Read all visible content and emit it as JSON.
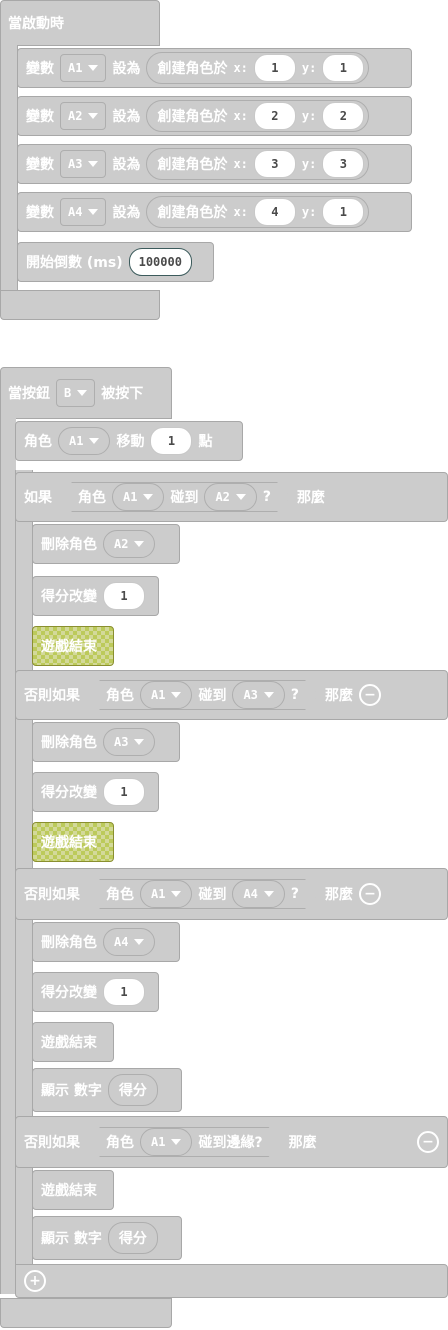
{
  "workspace": {
    "on_start": {
      "label": "當啟動時",
      "set_rows": [
        {
          "var_label": "變數",
          "var": "A1",
          "set_label": "設為",
          "create_label": "創建角色於",
          "x_label": "x:",
          "x": "1",
          "y_label": "y:",
          "y": "1"
        },
        {
          "var_label": "變數",
          "var": "A2",
          "set_label": "設為",
          "create_label": "創建角色於",
          "x_label": "x:",
          "x": "2",
          "y_label": "y:",
          "y": "2"
        },
        {
          "var_label": "變數",
          "var": "A3",
          "set_label": "設為",
          "create_label": "創建角色於",
          "x_label": "x:",
          "x": "3",
          "y_label": "y:",
          "y": "3"
        },
        {
          "var_label": "變數",
          "var": "A4",
          "set_label": "設為",
          "create_label": "創建角色於",
          "x_label": "x:",
          "x": "4",
          "y_label": "y:",
          "y": "1"
        }
      ],
      "countdown": {
        "label": "開始倒數 (ms)",
        "value": "100000"
      }
    },
    "on_button": {
      "label_prefix": "當按鈕",
      "button": "B",
      "label_suffix": "被按下",
      "move": {
        "sprite_label": "角色",
        "sprite": "A1",
        "action": "移動",
        "value": "1",
        "unit": "點"
      },
      "if1": {
        "kw": "如果",
        "sprite_label": "角色",
        "sprite": "A1",
        "touch": "碰到",
        "target": "A2",
        "q": "?",
        "then": "那麼",
        "delete_label": "刪除角色",
        "delete_target": "A2",
        "score_label": "得分改變",
        "score_value": "1",
        "game_over": "遊戲結束"
      },
      "elif1": {
        "kw": "否則如果",
        "sprite_label": "角色",
        "sprite": "A1",
        "touch": "碰到",
        "target": "A3",
        "q": "?",
        "then": "那麼",
        "delete_label": "刪除角色",
        "delete_target": "A3",
        "score_label": "得分改變",
        "score_value": "1",
        "game_over": "遊戲結束"
      },
      "elif2": {
        "kw": "否則如果",
        "sprite_label": "角色",
        "sprite": "A1",
        "touch": "碰到",
        "target": "A4",
        "q": "?",
        "then": "那麼",
        "delete_label": "刪除角色",
        "delete_target": "A4",
        "score_label": "得分改變",
        "score_value": "1",
        "game_over": "遊戲結束",
        "show_label": "顯示 數字",
        "show_value": "得分"
      },
      "elif3": {
        "kw": "否則如果",
        "sprite_label": "角色",
        "sprite": "A1",
        "edge": "碰到邊緣?",
        "then": "那麼",
        "game_over": "遊戲結束",
        "show_label": "顯示 數字",
        "show_value": "得分"
      }
    }
  },
  "colors": {
    "block": "#cccccc",
    "highlight": "#d3d99a",
    "text": "#ffffff"
  }
}
